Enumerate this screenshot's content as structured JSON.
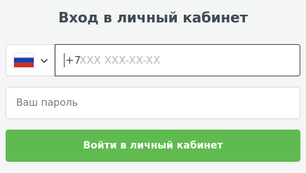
{
  "title": "Вход в личный кабинет",
  "phone": {
    "country_flag": "russia-flag-icon",
    "prefix": "+7",
    "placeholder": "XXX XXX-XX-XX",
    "value": ""
  },
  "password": {
    "placeholder": "Ваш пароль",
    "value": ""
  },
  "submit": {
    "label": "Войти в личный кабинет"
  },
  "colors": {
    "accent": "#5fbb4f",
    "title": "#3f4a52",
    "background": "#f4f5f5"
  }
}
